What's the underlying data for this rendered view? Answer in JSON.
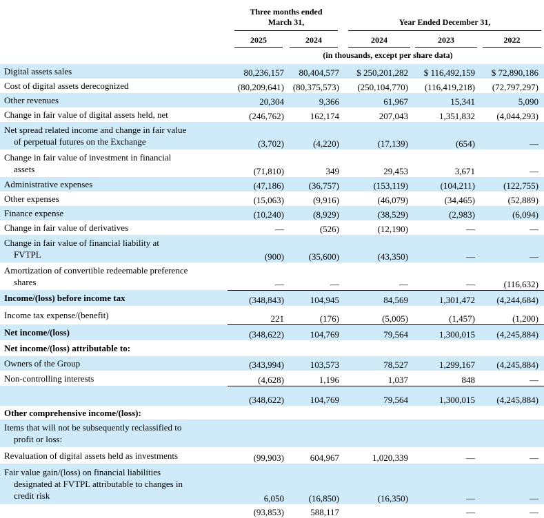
{
  "header": {
    "group_q": "Three months ended\nMarch 31,",
    "group_y": "Year Ended December 31,",
    "cols": [
      "2025",
      "2024",
      "2024",
      "2023",
      "2022"
    ],
    "units": "(in thousands, except per share data)"
  },
  "rows": [
    {
      "label": "Digital assets sales",
      "shade": true,
      "vals": [
        "80,236,157",
        "80,404,577",
        "$ 250,201,282",
        "$ 116,492,159",
        "$ 72,890,186"
      ]
    },
    {
      "label": "Cost of digital assets derecognized",
      "vals": [
        "(80,209,641)",
        "(80,375,573)",
        "(250,104,770)",
        "(116,419,218)",
        "(72,797,297)"
      ]
    },
    {
      "label": "Other revenues",
      "shade": true,
      "vals": [
        "20,304",
        "9,366",
        "61,967",
        "15,341",
        "5,090"
      ]
    },
    {
      "label": "Change in fair value of digital assets held, net",
      "vals": [
        "(246,762)",
        "162,174",
        "207,043",
        "1,351,832",
        "(4,044,293)"
      ]
    },
    {
      "label": "Net spread related income and change in fair value",
      "label2": "of perpetual futures on the Exchange",
      "shade": true,
      "vals": [
        "(3,702)",
        "(4,220)",
        "(17,139)",
        "(654)",
        "—"
      ]
    },
    {
      "label": "Change in fair value of investment in financial",
      "label2": "assets",
      "vals": [
        "(71,810)",
        "349",
        "29,453",
        "3,671",
        "—"
      ]
    },
    {
      "label": "Administrative expenses",
      "shade": true,
      "vals": [
        "(47,186)",
        "(36,757)",
        "(153,119)",
        "(104,211)",
        "(122,755)"
      ]
    },
    {
      "label": "Other expenses",
      "vals": [
        "(15,063)",
        "(9,916)",
        "(46,079)",
        "(34,465)",
        "(52,889)"
      ]
    },
    {
      "label": "Finance expense",
      "shade": true,
      "vals": [
        "(10,240)",
        "(8,929)",
        "(38,529)",
        "(2,983)",
        "(6,094)"
      ]
    },
    {
      "label": "Change in fair value of derivatives",
      "vals": [
        "—",
        "(526)",
        "(12,190)",
        "—",
        "—"
      ]
    },
    {
      "label": "Change in fair value of financial liability at",
      "label2": "FVTPL",
      "shade": true,
      "vals": [
        "(900)",
        "(35,600)",
        "(43,350)",
        "—",
        "—"
      ]
    },
    {
      "label": "Amortization of convertible redeemable preference",
      "label2": "shares",
      "vals": [
        "—",
        "—",
        "—",
        "—",
        "(116,632)"
      ]
    },
    {
      "label": "Income/(loss) before income tax",
      "shade": true,
      "bold": true,
      "top": true,
      "vals": [
        "(348,843)",
        "104,945",
        "84,569",
        "1,301,472",
        "(4,244,684)"
      ]
    },
    {
      "label": "Income tax expense/(benefit)",
      "vals": [
        "221",
        "(176)",
        "(5,005)",
        "(1,457)",
        "(1,200)"
      ]
    },
    {
      "label": "Net income/(loss)",
      "shade": true,
      "bold": true,
      "top": true,
      "vals": [
        "(348,622)",
        "104,769",
        "79,564",
        "1,300,015",
        "(4,245,884)"
      ]
    },
    {
      "label": "Net income/(loss) attributable to:",
      "bold": true,
      "vals": [
        "",
        "",
        "",
        "",
        ""
      ]
    },
    {
      "label": "Owners of the Group",
      "shade": true,
      "vals": [
        "(343,994)",
        "103,573",
        "78,527",
        "1,299,167",
        "(4,245,884)"
      ]
    },
    {
      "label": "Non-controlling interests",
      "vals": [
        "(4,628)",
        "1,196",
        "1,037",
        "848",
        "—"
      ]
    },
    {
      "label": "",
      "shade": true,
      "top": true,
      "vals": [
        "(348,622)",
        "104,769",
        "79,564",
        "1,300,015",
        "(4,245,884)"
      ]
    },
    {
      "label": "Other comprehensive income/(loss):",
      "bold": true,
      "vals": [
        "",
        "",
        "",
        "",
        ""
      ]
    },
    {
      "label": "Items that will not be subsequently reclassified to",
      "label2": "profit or loss:",
      "shade": true,
      "vals": [
        "",
        "",
        "",
        "",
        ""
      ]
    },
    {
      "label": "Revaluation of digital assets held as investments",
      "vals": [
        "(99,903)",
        "604,967",
        "1,020,339",
        "—",
        "—"
      ]
    },
    {
      "label": "Fair value gain/(loss) on financial liabilities",
      "label2": "designated at FVTPL attributable to changes in",
      "label3": "credit risk",
      "shade": true,
      "vals": [
        "6,050",
        "(16,850)",
        "(16,350)",
        "—",
        "—"
      ]
    },
    {
      "label": "",
      "vals": [
        "(93,853)",
        "588,117",
        "",
        "—",
        "—"
      ]
    }
  ]
}
